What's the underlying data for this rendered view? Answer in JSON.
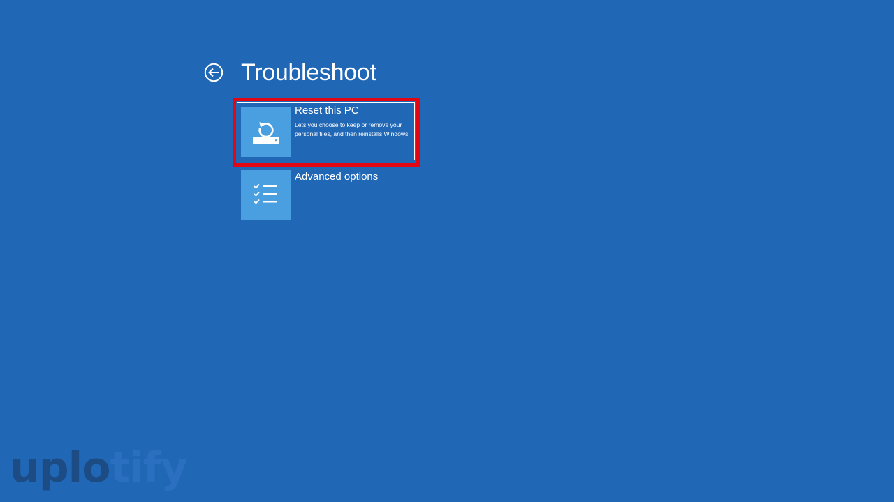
{
  "header": {
    "title": "Troubleshoot",
    "back_icon": "back-arrow-icon"
  },
  "options": [
    {
      "title": "Reset this PC",
      "description": "Lets you choose to keep or remove your personal files, and then reinstalls Windows.",
      "icon": "reset-pc-icon",
      "highlighted": true
    },
    {
      "title": "Advanced options",
      "description": "",
      "icon": "checklist-icon",
      "highlighted": false
    }
  ],
  "watermark": {
    "part1": "uplo",
    "part2": "tify"
  },
  "colors": {
    "background": "#2067b6",
    "tile": "#4a9fe0",
    "highlight": "#e30613"
  }
}
